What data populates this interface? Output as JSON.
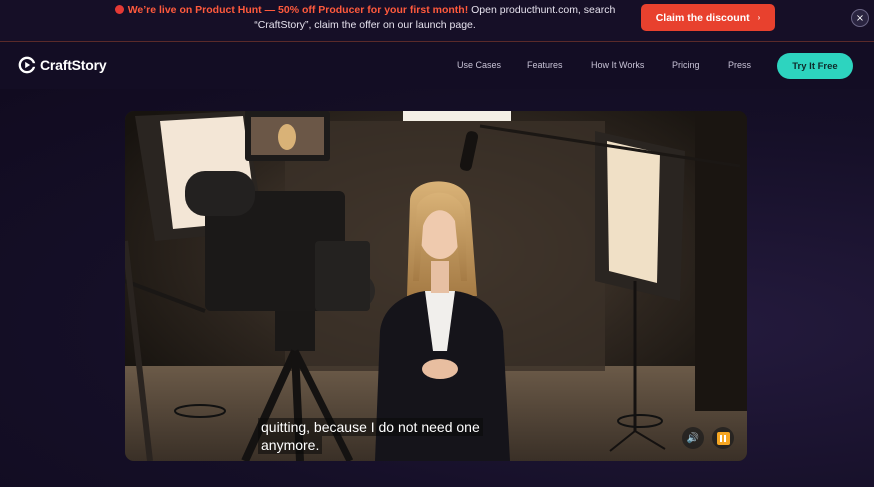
{
  "banner": {
    "highlight": "We’re live on Product Hunt — 50% off Producer for your first month!",
    "text": " Open producthunt.com, search “CraftStory”, claim the offer on our launch page.",
    "claim_label": "Claim the discount",
    "close_glyph": "×"
  },
  "nav": {
    "brand": "CraftStory",
    "links": [
      "Use Cases",
      "Features",
      "How It Works",
      "Pricing",
      "Press"
    ],
    "cta": "Try It Free"
  },
  "video": {
    "caption_line1": "quitting, because I do not need one",
    "caption_line2": "anymore.",
    "mute_glyph": "🔊"
  },
  "colors": {
    "accent": "#2dd4bf",
    "promo": "#e8412e",
    "background": "#120d22"
  }
}
